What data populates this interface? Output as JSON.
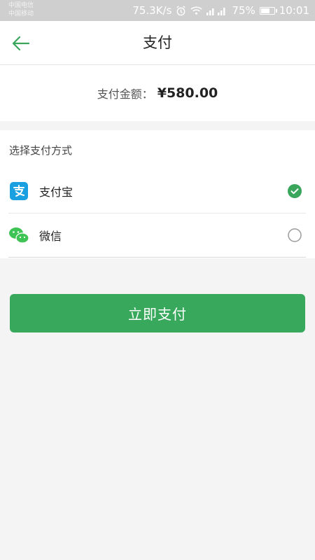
{
  "status_bar": {
    "carrier1": "中国电信",
    "carrier2": "中国移动",
    "speed": "75.3K/s",
    "battery": "75%",
    "battery_level": 0.75,
    "time": "10:01",
    "icons": [
      "alarm-icon",
      "wifi-icon",
      "signal-icon",
      "battery-icon"
    ]
  },
  "nav": {
    "title": "支付",
    "back_icon": "back-arrow-icon",
    "accent": "#3aa65c"
  },
  "amount": {
    "label": "支付金额：",
    "value": "¥580.00"
  },
  "payment_methods": {
    "title": "选择支付方式",
    "items": [
      {
        "name": "支付宝",
        "icon": "alipay-icon",
        "selected": true
      },
      {
        "name": "微信",
        "icon": "wechat-icon",
        "selected": false
      }
    ]
  },
  "pay_button": {
    "label": "立即支付",
    "color": "#38a95c"
  }
}
